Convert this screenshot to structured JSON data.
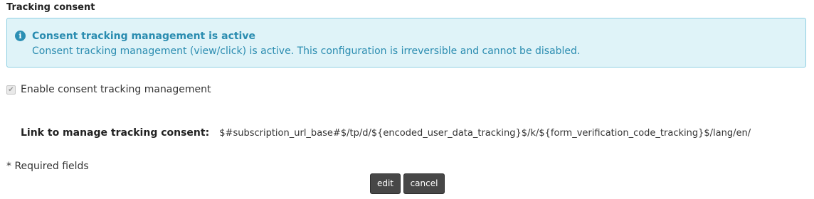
{
  "section": {
    "title": "Tracking consent"
  },
  "alert": {
    "icon": "info-icon",
    "heading": "Consent tracking management is active",
    "text": "Consent tracking management (view/click) is active. This configuration is irreversible and cannot be disabled.",
    "colors": {
      "background": "#dff3f8",
      "border": "#8fcfe3",
      "text": "#2a8cb0"
    }
  },
  "consent_checkbox": {
    "label": "Enable consent tracking management",
    "checked": true,
    "disabled": true
  },
  "link": {
    "label": "Link to manage tracking consent:",
    "value": "$#subscription_url_base#$/tp/d/${encoded_user_data_tracking}$/k/${form_verification_code_tracking}$/lang/en/"
  },
  "form": {
    "required_note": "* Required fields"
  },
  "buttons": {
    "edit_label": "edit",
    "cancel_label": "cancel",
    "color": "#474747"
  }
}
